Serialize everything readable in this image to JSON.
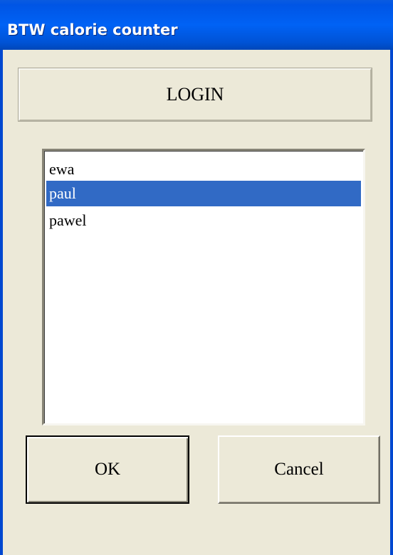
{
  "window": {
    "title": "BTW calorie counter",
    "titlebar_color": "#0055e5",
    "background_color": "#ece9d8"
  },
  "header": {
    "label": "LOGIN"
  },
  "user_list": {
    "items": [
      {
        "label": "ewa",
        "selected": false
      },
      {
        "label": "paul",
        "selected": true
      },
      {
        "label": "pawel",
        "selected": false
      }
    ],
    "selection_color": "#316ac5"
  },
  "buttons": {
    "ok_label": "OK",
    "cancel_label": "Cancel"
  }
}
